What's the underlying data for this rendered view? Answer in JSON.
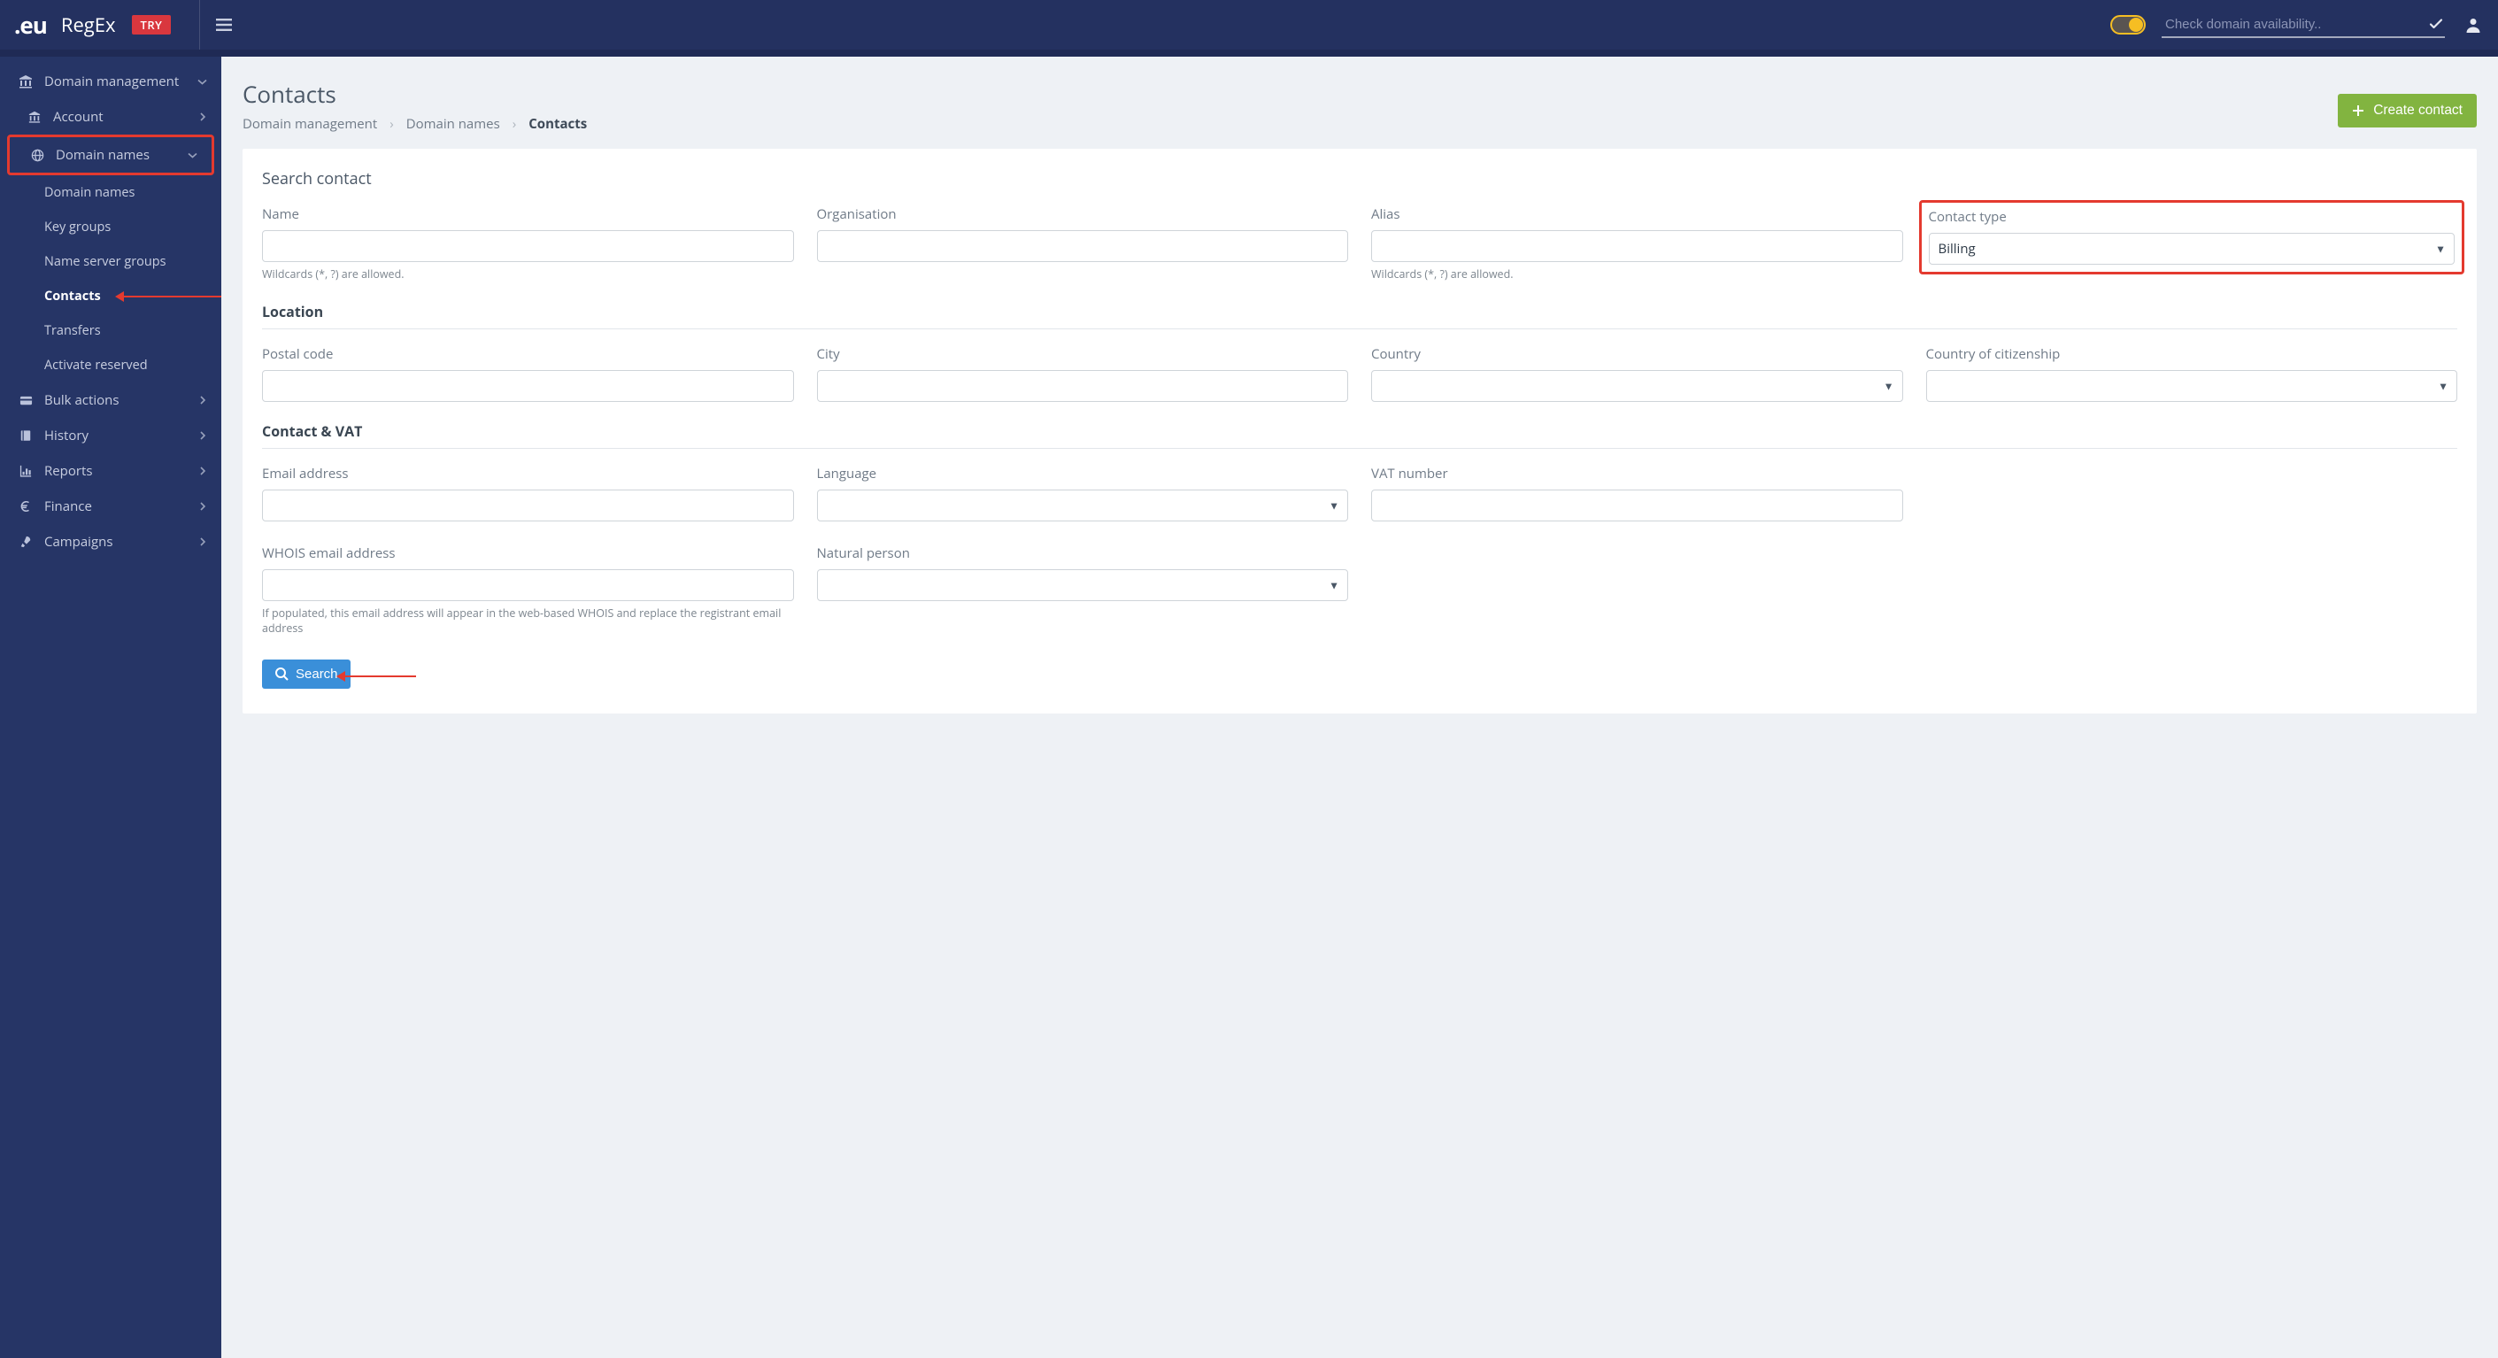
{
  "brand": {
    "eu": ".eu",
    "regex": "RegEx",
    "try": "TRY"
  },
  "top": {
    "search_placeholder": "Check domain availability.."
  },
  "sidebar": {
    "domain_mgmt": "Domain management",
    "account": "Account",
    "domain_names": "Domain names",
    "sub": {
      "domain_names": "Domain names",
      "key_groups": "Key groups",
      "name_server_groups": "Name server groups",
      "contacts": "Contacts",
      "transfers": "Transfers",
      "activate_reserved": "Activate reserved"
    },
    "bulk_actions": "Bulk actions",
    "history": "History",
    "reports": "Reports",
    "finance": "Finance",
    "campaigns": "Campaigns"
  },
  "page": {
    "title": "Contacts",
    "crumbs": {
      "a": "Domain management",
      "b": "Domain names",
      "c": "Contacts"
    },
    "create": "Create contact"
  },
  "form": {
    "search_contact": "Search contact",
    "name": "Name",
    "organisation": "Organisation",
    "alias": "Alias",
    "contact_type": "Contact type",
    "contact_type_value": "Billing",
    "wildcards": "Wildcards (*, ?) are allowed.",
    "location": "Location",
    "postal": "Postal code",
    "city": "City",
    "country": "Country",
    "citizenship": "Country of citizenship",
    "contact_vat": "Contact & VAT",
    "email": "Email address",
    "language": "Language",
    "vat": "VAT number",
    "whois_email": "WHOIS email address",
    "natural": "Natural person",
    "whois_hint": "If populated, this email address will appear in the web-based WHOIS and replace the registrant email address",
    "search_btn": "Search"
  }
}
